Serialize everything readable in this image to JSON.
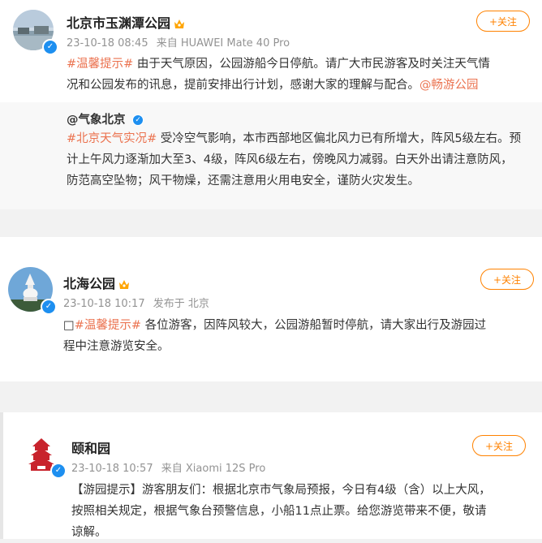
{
  "posts": [
    {
      "name": "北京市玉渊潭公园",
      "time": "23-10-18 08:45",
      "source": "来自 HUAWEI Mate 40 Pro",
      "follow": "+关注",
      "tag": "#温馨提示#",
      "text_1": " 由于天气原因，公园游船今日停航。请广大市民游客及时关注天气情",
      "text_2": "况和公园发布的讯息，提前安排出行计划，感谢大家的理解与配合。",
      "mention": "@畅游公园",
      "repost": {
        "name": "@气象北京",
        "tag": "#北京天气实况#",
        "text_1": " 受冷空气影响，本市西部地区偏北风力已有所增大，阵风5级左右。预",
        "text_2": "计上午风力逐渐加大至3、4级，阵风6级左右，傍晚风力减弱。白天外出请注意防风，",
        "text_3": "防范高空坠物；风干物燥，还需注意用火用电安全，谨防火灾发生。"
      }
    },
    {
      "name": "北海公园",
      "time": "23-10-18 10:17",
      "source": "发布于 北京",
      "follow": "+关注",
      "prefix": "□",
      "tag": "#温馨提示#",
      "text_1": " 各位游客，因阵风较大，公园游船暂时停航，请大家出行及游园过",
      "text_2": "程中注意游览安全。"
    },
    {
      "name": "颐和园",
      "time": "23-10-18 10:57",
      "source": "来自 Xiaomi 12S Pro",
      "follow": "+关注",
      "text_1": "【游园提示】游客朋友们：根据北京市气象局预报，今日有4级（含）以上大风，",
      "text_2": "按照相关规定，根据气象台预警信息，小船11点止票。给您游览带来不便，敬请",
      "text_3": "谅解。"
    }
  ],
  "colors": {
    "accent": "#ff8200",
    "topic": "#eb7350",
    "verified": "#1d8ff0"
  },
  "icons": [
    "verified-icon",
    "crown-icon"
  ]
}
